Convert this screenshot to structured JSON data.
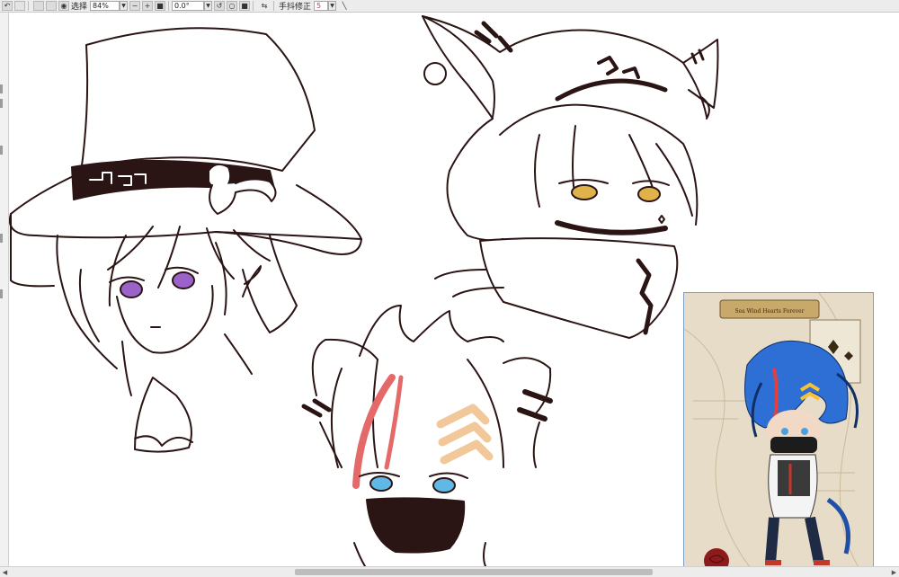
{
  "toolbar": {
    "select_label": "选择",
    "zoom_value": "84%",
    "rotation_value": "0.0°",
    "stabilizer_label": "手抖修正",
    "stabilizer_value": "5"
  },
  "reference_panel": {
    "banner_text": "Sea Wind Hearts Forever"
  },
  "colors": {
    "line_art": "#2b1414",
    "iris_purple": "#9b63c9",
    "iris_gold": "#e0b34a",
    "iris_cyan": "#5fb8e6",
    "hair_red_stripe": "#e46a6a",
    "chevron_peach": "#f2c79a",
    "ref_blue_hair": "#2e6fd6"
  }
}
